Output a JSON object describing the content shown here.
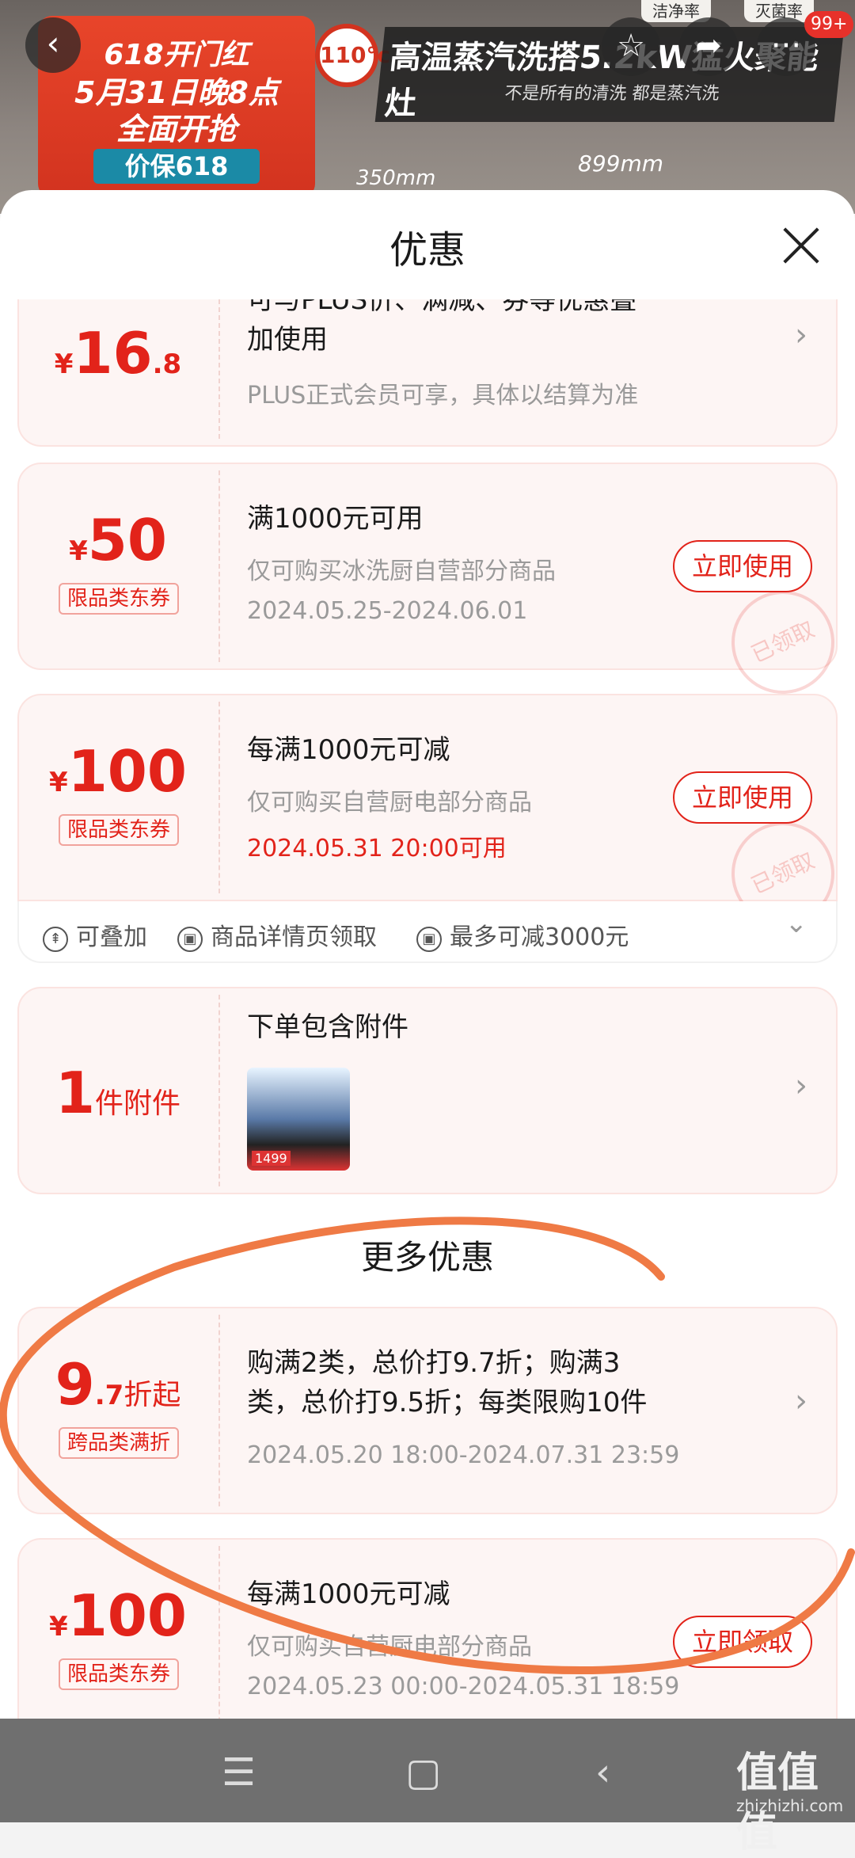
{
  "banner": {
    "promo_line1": "618开门红",
    "promo_line2": "5月31日晚8点",
    "promo_line3": "全面开抢",
    "promo_tag": "价保618",
    "temp_label": "110°c",
    "slogan_title": "高温蒸汽洗搭5.2kW猛火聚能灶",
    "slogan_sub": "不是所有的清洗 都是蒸汽洗",
    "dim_left": "350mm",
    "dim_right": "899mm",
    "tag_left": "洁净率",
    "tag_right": "灭菌率",
    "cart_badge": "99+"
  },
  "topbar": {
    "back_icon": "back-arrow-icon",
    "favorite_icon": "star-icon",
    "share_icon": "share-icon",
    "more_icon": "more-icon"
  },
  "sheet": {
    "title": "优惠",
    "close_icon": "close-icon"
  },
  "cards": [
    {
      "amount_currency": "¥",
      "amount_int": "16",
      "amount_dec": ".8",
      "title": "可与PLUS价、满减、券等优惠叠加使用",
      "title_line1": "可与PLUS价、满减、券等优惠叠",
      "title_line2": "加使用",
      "sub": "PLUS正式会员可享，具体以结算为准"
    },
    {
      "amount_currency": "¥",
      "amount_int": "50",
      "tag": "限品类东券",
      "title": "满1000元可用",
      "sub": "仅可购买冰洗厨自营部分商品",
      "date": "2024.05.25-2024.06.01",
      "button": "立即使用",
      "stamp": "已领取"
    },
    {
      "amount_currency": "¥",
      "amount_int": "100",
      "tag": "限品类东券",
      "title": "每满1000元可减",
      "sub": "仅可购买自营厨电部分商品",
      "date": "2024.05.31 20:00可用",
      "button": "立即使用",
      "stamp": "已领取",
      "features": [
        "可叠加",
        "商品详情页领取",
        "最多可减3000元"
      ]
    },
    {
      "amount_int": "1",
      "amount_unit": "件附件",
      "title": "下单包含附件",
      "thumb_price": "1499"
    }
  ],
  "more_section": {
    "heading": "更多优惠",
    "cards": [
      {
        "amount_int": "9",
        "amount_dec": ".7",
        "amount_unit": "折起",
        "tag": "跨品类满折",
        "title_line1": "购满2类，总价打9.7折；购满3",
        "title_line2": "类，总价打9.5折；每类限购10件",
        "date": "2024.05.20 18:00-2024.07.31 23:59"
      },
      {
        "amount_currency": "¥",
        "amount_int": "100",
        "tag": "限品类东券",
        "title": "每满1000元可减",
        "sub": "仅可购买自营厨电部分商品",
        "date": "2024.05.23 00:00-2024.05.31 18:59",
        "button": "立即领取"
      }
    ]
  },
  "navbar": {
    "menu_icon": "menu-icon",
    "home_icon": "home-square-icon",
    "back_icon": "back-chevron-icon"
  },
  "watermark": {
    "text": "值值值",
    "url": "zhizhizhi.com"
  },
  "colors": {
    "accent": "#e2231a",
    "card_bg": "#fdf5f4",
    "scribble": "#ef7a45"
  }
}
